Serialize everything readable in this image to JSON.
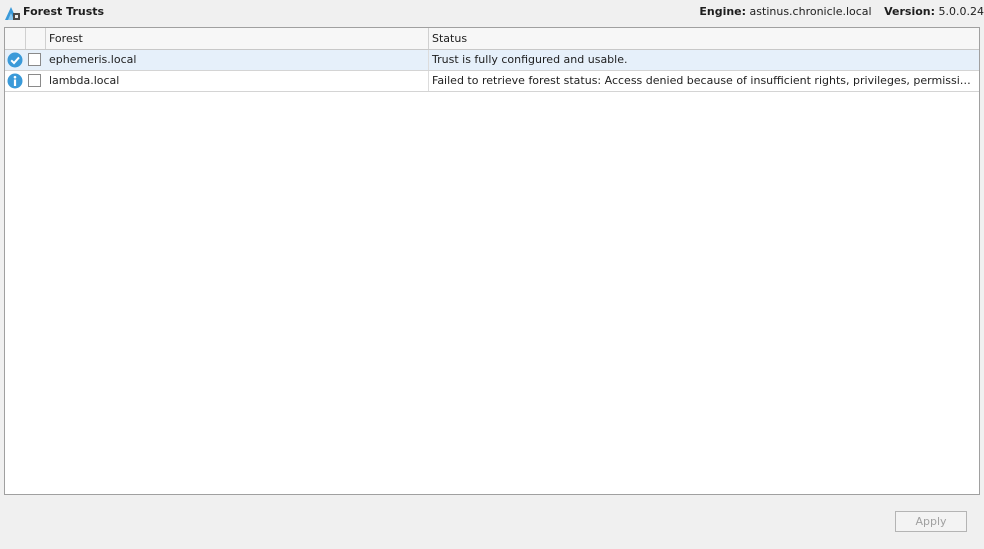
{
  "header": {
    "title": "Forest Trusts",
    "engine_label": "Engine:",
    "engine_value": "astinus.chronicle.local",
    "version_label": "Version:",
    "version_value": "5.0.0.24"
  },
  "grid": {
    "columns": {
      "forest": "Forest",
      "status": "Status"
    },
    "rows": [
      {
        "icon": "check-circle-icon",
        "checked": false,
        "forest": "ephemeris.local",
        "status": "Trust is fully configured and usable.",
        "selected": true
      },
      {
        "icon": "info-circle-icon",
        "checked": false,
        "forest": "lambda.local",
        "status": "Failed to retrieve forest status: Access denied because of insufficient rights, privileges, permissions or the file …",
        "selected": false
      }
    ]
  },
  "footer": {
    "apply_label": "Apply"
  },
  "colors": {
    "accent": "#3a9ad9",
    "selection": "#e6f0fa"
  }
}
